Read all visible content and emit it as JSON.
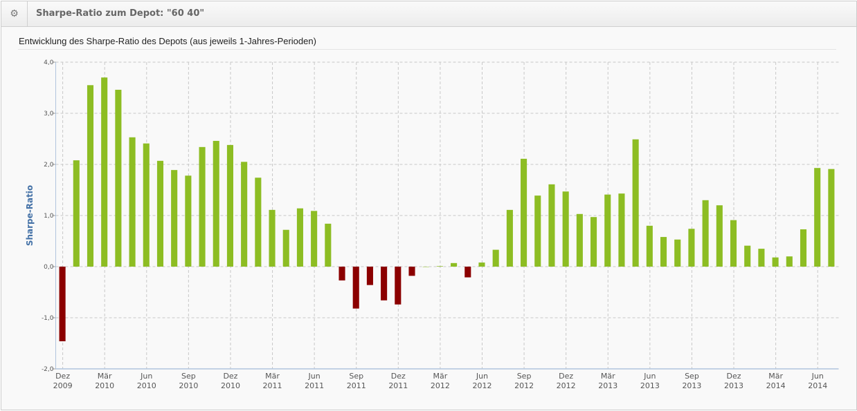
{
  "header": {
    "title": "Sharpe-Ratio zum Depot: \"60 40\"",
    "icon": "gear-icon"
  },
  "chart_data": {
    "type": "bar",
    "title": "Entwicklung des Sharpe-Ratio des Depots (aus jeweils 1-Jahres-Perioden)",
    "ylabel": "Sharpe-Ratio",
    "xlabel": "",
    "ylim": [
      -2,
      4
    ],
    "yticks": [
      "-2,0",
      "-1,0",
      "0,0",
      "1,0",
      "2,0",
      "3,0",
      "4,0"
    ],
    "xticks": [
      [
        "Dez",
        "2009"
      ],
      [
        "Mär",
        "2010"
      ],
      [
        "Jun",
        "2010"
      ],
      [
        "Sep",
        "2010"
      ],
      [
        "Dez",
        "2010"
      ],
      [
        "Mär",
        "2011"
      ],
      [
        "Jun",
        "2011"
      ],
      [
        "Sep",
        "2011"
      ],
      [
        "Dez",
        "2011"
      ],
      [
        "Mär",
        "2012"
      ],
      [
        "Jun",
        "2012"
      ],
      [
        "Sep",
        "2012"
      ],
      [
        "Dez",
        "2012"
      ],
      [
        "Mär",
        "2013"
      ],
      [
        "Jun",
        "2013"
      ],
      [
        "Sep",
        "2013"
      ],
      [
        "Dez",
        "2013"
      ],
      [
        "Mär",
        "2014"
      ],
      [
        "Jun",
        "2014"
      ]
    ],
    "first_month": "Dez 2009",
    "last_month": "Jul 2014",
    "values": [
      -1.46,
      2.08,
      3.55,
      3.7,
      3.46,
      2.53,
      2.41,
      2.07,
      1.89,
      1.78,
      2.34,
      2.46,
      2.38,
      2.05,
      1.74,
      1.11,
      0.72,
      1.14,
      1.09,
      0.84,
      -0.27,
      -0.82,
      -0.36,
      -0.66,
      -0.74,
      -0.18,
      0.0,
      0.01,
      0.07,
      -0.21,
      0.08,
      0.33,
      1.11,
      2.11,
      1.39,
      1.61,
      1.47,
      1.03,
      0.97,
      1.41,
      1.43,
      2.49,
      0.8,
      0.58,
      0.53,
      0.74,
      1.3,
      1.2,
      0.91,
      0.41,
      0.35,
      0.18,
      0.2,
      0.73,
      1.93,
      1.91
    ],
    "colors": {
      "positive": "#8dbd23",
      "negative": "#8b0000",
      "grid": "#c8c8c8",
      "axis": "#b0c4de"
    }
  }
}
